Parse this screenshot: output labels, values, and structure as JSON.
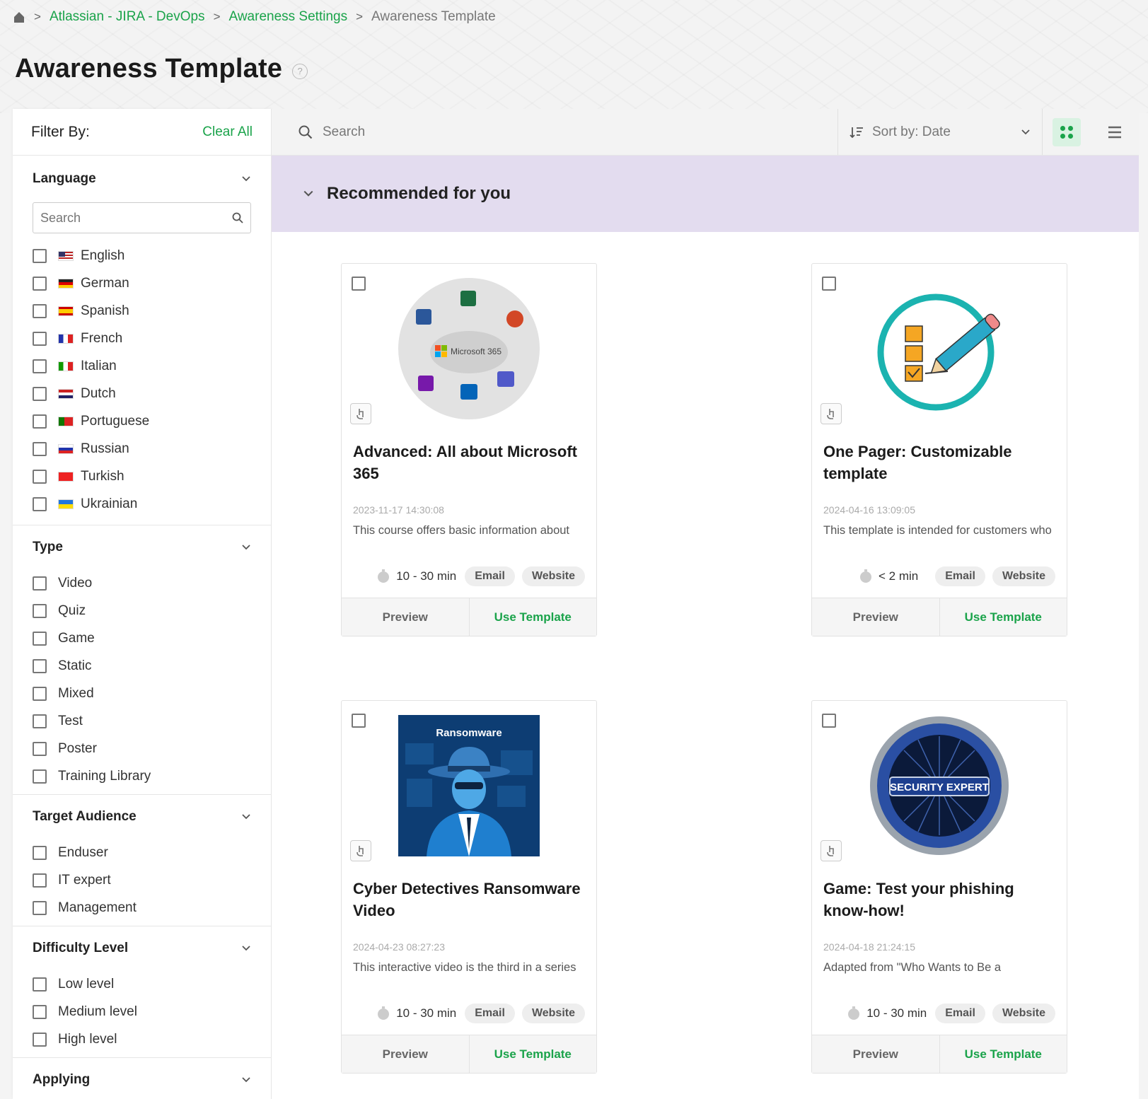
{
  "breadcrumb": {
    "items": [
      "Atlassian - JIRA - DevOps",
      "Awareness Settings"
    ],
    "current": "Awareness Template",
    "sep": ">"
  },
  "page": {
    "title": "Awareness Template",
    "help": "?"
  },
  "filter": {
    "title": "Filter By:",
    "clear_all": "Clear All",
    "language": {
      "label": "Language",
      "search_placeholder": "Search",
      "options": [
        "English",
        "German",
        "Spanish",
        "French",
        "Italian",
        "Dutch",
        "Portuguese",
        "Russian",
        "Turkish",
        "Ukrainian"
      ]
    },
    "type": {
      "label": "Type",
      "options": [
        "Video",
        "Quiz",
        "Game",
        "Static",
        "Mixed",
        "Test",
        "Poster",
        "Training Library"
      ]
    },
    "audience": {
      "label": "Target Audience",
      "options": [
        "Enduser",
        "IT expert",
        "Management"
      ]
    },
    "difficulty": {
      "label": "Difficulty Level",
      "options": [
        "Low level",
        "Medium level",
        "High level"
      ]
    },
    "applying": {
      "label": "Applying"
    }
  },
  "toolbar": {
    "search_placeholder": "Search",
    "sort_label": "Sort by: Date"
  },
  "section": {
    "title": "Recommended for you"
  },
  "cards": [
    {
      "title": "Advanced: All about Microsoft 365",
      "date": "2023-11-17 14:30:08",
      "desc": "This course offers basic information about",
      "duration": "10 - 30 min",
      "tags": [
        "Email",
        "Website"
      ],
      "preview": "Preview",
      "use": "Use Template",
      "thumb_text": "Microsoft 365"
    },
    {
      "title": "One Pager: Customizable template",
      "date": "2024-04-16 13:09:05",
      "desc": "This template is intended for customers who",
      "duration": "< 2 min",
      "tags": [
        "Email",
        "Website"
      ],
      "preview": "Preview",
      "use": "Use Template"
    },
    {
      "title": "Cyber Detectives Ransomware Video",
      "date": "2024-04-23 08:27:23",
      "desc": "This interactive video is the third in a series",
      "duration": "10 - 30 min",
      "tags": [
        "Email",
        "Website"
      ],
      "preview": "Preview",
      "use": "Use Template",
      "thumb_text": "Ransomware"
    },
    {
      "title": "Game: Test your phishing know-how!",
      "date": "2024-04-18 21:24:15",
      "desc": "Adapted from \"Who Wants to Be a",
      "duration": "10 - 30 min",
      "tags": [
        "Email",
        "Website"
      ],
      "preview": "Preview",
      "use": "Use Template",
      "thumb_text": "SECURITY EXPERT"
    }
  ],
  "colors": {
    "accent": "#1aa34a",
    "band": "#e3dcef"
  }
}
